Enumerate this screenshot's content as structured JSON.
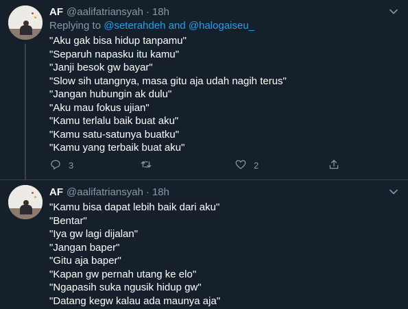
{
  "tweets": [
    {
      "name": "AF",
      "handle": "@aalifatriansyah",
      "separator": "·",
      "time": "18h",
      "reply": {
        "prefix": "Replying to ",
        "mention1": "@seterahdeh",
        "joiner": " and ",
        "mention2": "@halogaiseu_"
      },
      "lines": [
        "\"Aku gak bisa hidup tanpamu\"",
        "\"Separuh napasku itu kamu\"",
        "\"Janji besok gw bayar\"",
        "\"Slow sih utangnya, masa gitu aja udah nagih terus\"",
        "\"Jangan hubungin ak dulu\"",
        "\"Aku mau fokus ujian\"",
        "\"Kamu terlalu baik buat aku\"",
        "\"Kamu satu-satunya buatku\"",
        "\"Kamu yang terbaik buat aku\""
      ],
      "actions": {
        "reply_count": "3",
        "like_count": "2"
      }
    },
    {
      "name": "AF",
      "handle": "@aalifatriansyah",
      "separator": "·",
      "time": "18h",
      "lines": [
        "\"Kamu bisa dapat lebih baik dari aku\"",
        "\"Bentar\"",
        "\"Iya gw lagi dijalan\"",
        "\"Jangan baper\"",
        "\"Gitu aja baper\"",
        "\"Kapan gw pernah utang ke elo\"",
        "\"Ngapasih suka ngusik hidup gw\"",
        "\"Datang kegw kalau ada maunya aja\""
      ]
    }
  ],
  "icons": {
    "caret": "chevron-down-icon",
    "reply": "reply-icon",
    "retweet": "retweet-icon",
    "like": "heart-icon",
    "share": "share-icon"
  },
  "colors": {
    "background": "#15202b",
    "text": "#ffffff",
    "secondary": "#8899a6",
    "link": "#1da1f2",
    "divider": "#38444d"
  }
}
